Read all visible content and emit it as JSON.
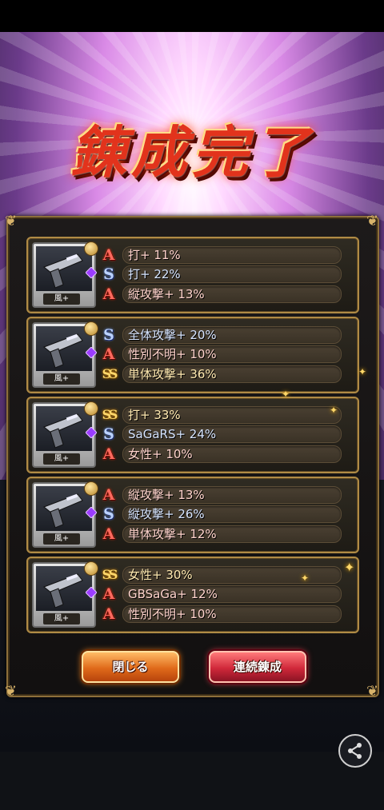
{
  "title": "錬成完了",
  "items": [
    {
      "element": "風+",
      "stats": [
        {
          "rank": "A",
          "text": "打+ 11%"
        },
        {
          "rank": "S",
          "text": "打+ 22%"
        },
        {
          "rank": "A",
          "text": "縦攻撃+ 13%"
        }
      ]
    },
    {
      "element": "風+",
      "stats": [
        {
          "rank": "S",
          "text": "全体攻撃+ 20%"
        },
        {
          "rank": "A",
          "text": "性別不明+ 10%"
        },
        {
          "rank": "SS",
          "text": "単体攻撃+ 36%"
        }
      ]
    },
    {
      "element": "風+",
      "stats": [
        {
          "rank": "SS",
          "text": "打+ 33%"
        },
        {
          "rank": "S",
          "text": "SaGaRS+ 24%"
        },
        {
          "rank": "A",
          "text": "女性+ 10%"
        }
      ]
    },
    {
      "element": "風+",
      "stats": [
        {
          "rank": "A",
          "text": "縦攻撃+ 13%"
        },
        {
          "rank": "S",
          "text": "縦攻撃+ 26%"
        },
        {
          "rank": "A",
          "text": "単体攻撃+ 12%"
        }
      ]
    },
    {
      "element": "風+",
      "stats": [
        {
          "rank": "SS",
          "text": "女性+ 30%"
        },
        {
          "rank": "A",
          "text": "GBSaGa+ 12%"
        },
        {
          "rank": "A",
          "text": "性別不明+ 10%"
        }
      ]
    }
  ],
  "buttons": {
    "close": "閉じる",
    "continue_forge": "連続錬成"
  },
  "icons": {
    "share": "share-icon",
    "weapon": "pistol-icon",
    "gem": "purple-gem-icon"
  },
  "colors": {
    "rank_A": "#ff6a5e",
    "rank_S": "#bcd3ff",
    "rank_SS": "#ffd76a",
    "frame_gold": "#b08b45"
  }
}
